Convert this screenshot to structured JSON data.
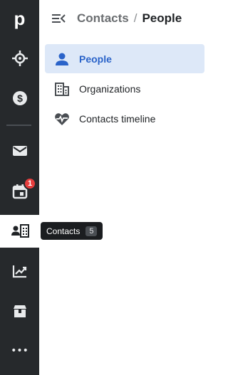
{
  "rail": {
    "items": [
      {
        "name": "logo",
        "icon": "pipedrive-logo",
        "glyph": "p"
      },
      {
        "name": "focus",
        "icon": "target-icon"
      },
      {
        "name": "deals",
        "icon": "dollar-icon"
      },
      {
        "name": "mail",
        "icon": "mail-icon"
      },
      {
        "name": "activities",
        "icon": "calendar-icon",
        "badge": "1"
      },
      {
        "name": "contacts",
        "icon": "contacts-icon",
        "active": true
      },
      {
        "name": "insights",
        "icon": "trend-icon"
      },
      {
        "name": "products",
        "icon": "box-icon"
      },
      {
        "name": "more",
        "icon": "more-icon",
        "glyph": "•••"
      }
    ]
  },
  "breadcrumb": {
    "parent": "Contacts",
    "separator": "/",
    "current": "People"
  },
  "nav": {
    "items": [
      {
        "label": "People",
        "icon": "person-icon",
        "active": true
      },
      {
        "label": "Organizations",
        "icon": "building-icon"
      },
      {
        "label": "Contacts timeline",
        "icon": "pulse-icon"
      }
    ]
  },
  "tooltip": {
    "label": "Contacts",
    "count": "5"
  },
  "colors": {
    "rail_bg": "#26292c",
    "active_bg": "#dde8f8",
    "accent": "#2a63c9",
    "badge": "#e63d3d"
  }
}
